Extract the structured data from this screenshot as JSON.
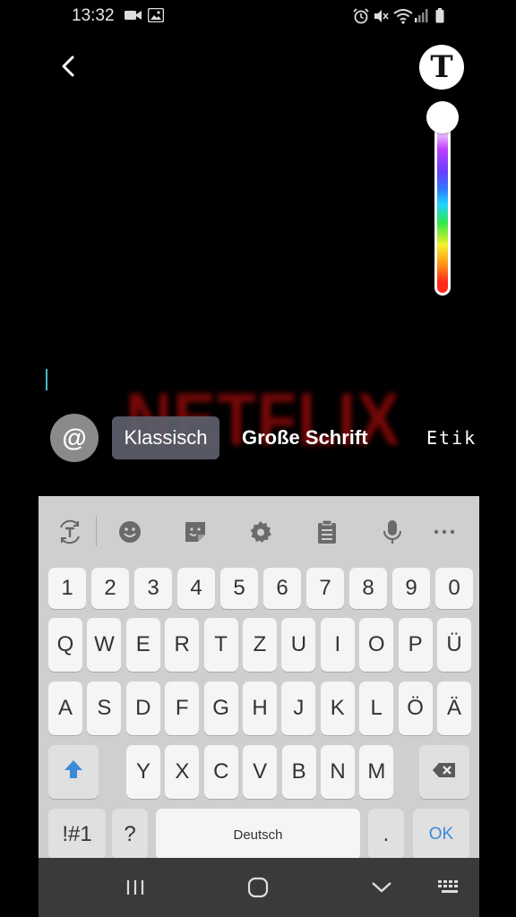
{
  "status_bar": {
    "time": "13:32",
    "left_icons": [
      "video-icon",
      "image-icon"
    ],
    "right_icons": [
      "alarm-icon",
      "mute-icon",
      "wifi-icon",
      "signal-icon",
      "battery-icon"
    ]
  },
  "editor": {
    "back_icon": "chevron-left-icon",
    "text_style_label": "T",
    "watermark_text": "NETFLIX"
  },
  "text_styles": {
    "mention_label": "@",
    "options": [
      "Klassisch",
      "Große Schrift",
      "Etik"
    ],
    "selected": "Klassisch"
  },
  "keyboard": {
    "toolbar_icons": [
      "text-translate-icon",
      "emoji-icon",
      "sticker-icon",
      "gear-icon",
      "clipboard-icon",
      "microphone-icon",
      "more-icon"
    ],
    "rows": {
      "numbers": [
        "1",
        "2",
        "3",
        "4",
        "5",
        "6",
        "7",
        "8",
        "9",
        "0"
      ],
      "row1": [
        "Q",
        "W",
        "E",
        "R",
        "T",
        "Z",
        "U",
        "I",
        "O",
        "P",
        "Ü"
      ],
      "row2": [
        "A",
        "S",
        "D",
        "F",
        "G",
        "H",
        "J",
        "K",
        "L",
        "Ö",
        "Ä"
      ],
      "row3": [
        "Y",
        "X",
        "C",
        "V",
        "B",
        "N",
        "M"
      ]
    },
    "symbols_label": "!#1",
    "question_label": "?",
    "space_label": "Deutsch",
    "period_label": ".",
    "ok_label": "OK",
    "colors": {
      "accent": "#3b8ad8",
      "shift": "#3b8ad8"
    }
  },
  "nav_bar": {
    "icons": [
      "recent-apps-icon",
      "home-icon",
      "hide-keyboard-icon",
      "keyboard-switch-icon"
    ]
  }
}
